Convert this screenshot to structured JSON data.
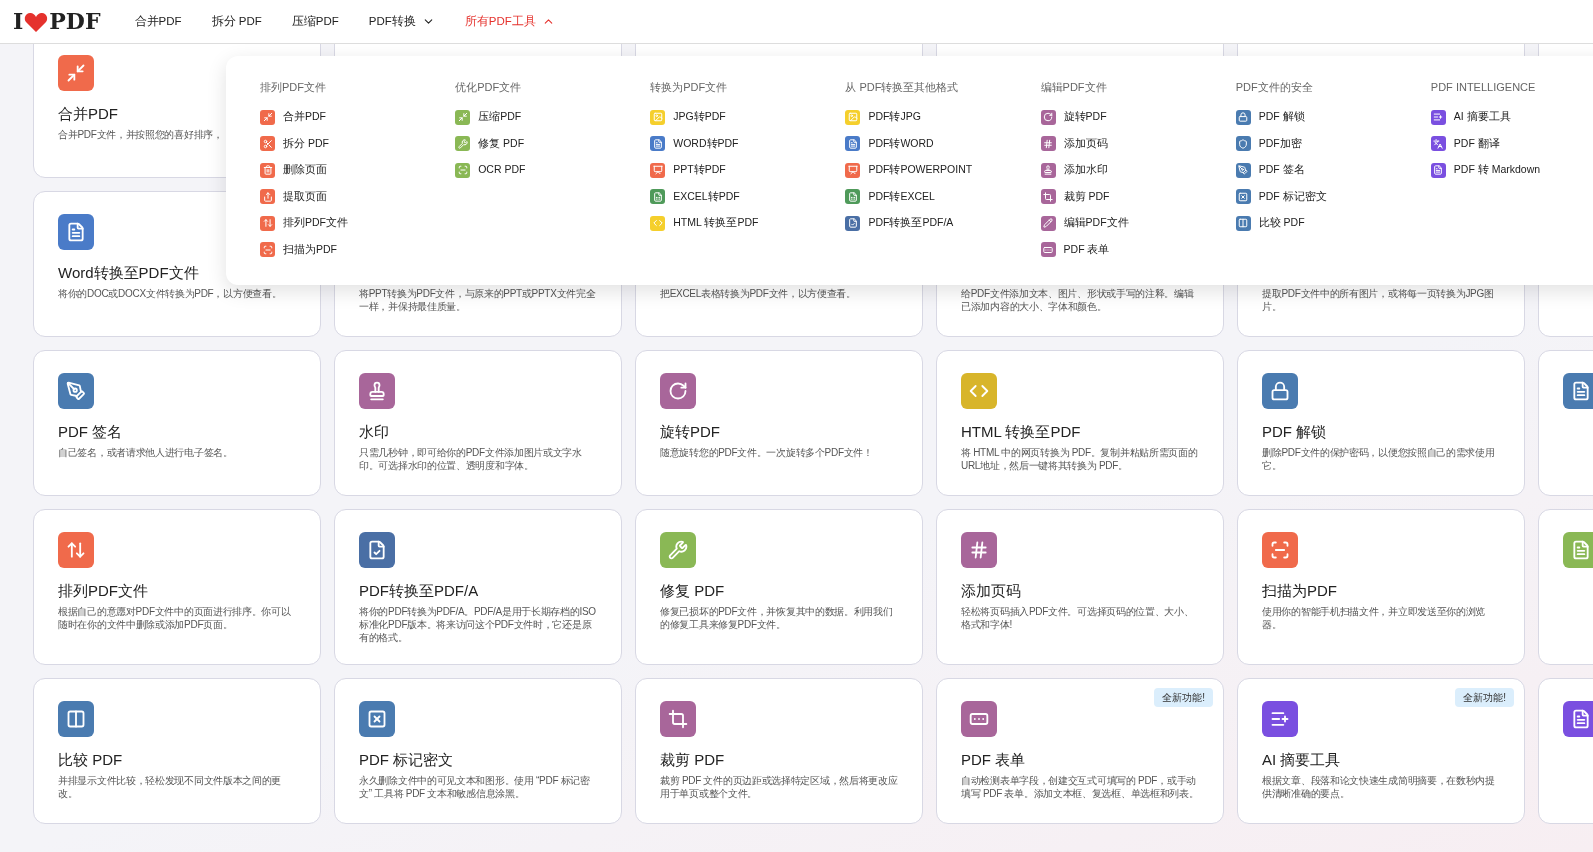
{
  "logo": {
    "left": "I",
    "right": "PDF"
  },
  "nav": [
    {
      "label": "合并PDF",
      "kind": "link",
      "selected": false
    },
    {
      "label": "拆分 PDF",
      "kind": "link",
      "selected": false
    },
    {
      "label": "压缩PDF",
      "kind": "link",
      "selected": false
    },
    {
      "label": "PDF转换",
      "kind": "menu",
      "selected": false,
      "expanded": false
    },
    {
      "label": "所有PDF工具",
      "kind": "menu",
      "selected": true,
      "expanded": true
    }
  ],
  "menu": [
    {
      "heading": "排列PDF文件",
      "items": [
        {
          "label": "合并PDF",
          "color": "#f06a4b"
        },
        {
          "label": "拆分 PDF",
          "color": "#f06a4b"
        },
        {
          "label": "删除页面",
          "color": "#f06a4b"
        },
        {
          "label": "提取页面",
          "color": "#f06a4b"
        },
        {
          "label": "排列PDF文件",
          "color": "#f06a4b"
        },
        {
          "label": "扫描为PDF",
          "color": "#f06a4b"
        }
      ]
    },
    {
      "heading": "优化PDF文件",
      "items": [
        {
          "label": "压缩PDF",
          "color": "#8ab855"
        },
        {
          "label": "修复 PDF",
          "color": "#8ab855"
        },
        {
          "label": "OCR PDF",
          "color": "#8ab855"
        }
      ]
    },
    {
      "heading": "转换为PDF文件",
      "items": [
        {
          "label": "JPG转PDF",
          "color": "#f5cf2c"
        },
        {
          "label": "WORD转PDF",
          "color": "#4a7bc8"
        },
        {
          "label": "PPT转PDF",
          "color": "#f06a4b"
        },
        {
          "label": "EXCEL转PDF",
          "color": "#4f9a5a"
        },
        {
          "label": "HTML 转换至PDF",
          "color": "#f5cf2c"
        }
      ]
    },
    {
      "heading": "从 PDF转换至其他格式",
      "items": [
        {
          "label": "PDF转JPG",
          "color": "#f5cf2c"
        },
        {
          "label": "PDF转WORD",
          "color": "#4a7bc8"
        },
        {
          "label": "PDF转POWERPOINT",
          "color": "#f06a4b"
        },
        {
          "label": "PDF转EXCEL",
          "color": "#4f9a5a"
        },
        {
          "label": "PDF转换至PDF/A",
          "color": "#4a6fa5"
        }
      ]
    },
    {
      "heading": "编辑PDF文件",
      "items": [
        {
          "label": "旋转PDF",
          "color": "#a8669a"
        },
        {
          "label": "添加页码",
          "color": "#a8669a"
        },
        {
          "label": "添加水印",
          "color": "#a8669a"
        },
        {
          "label": "裁剪 PDF",
          "color": "#a8669a"
        },
        {
          "label": "编辑PDF文件",
          "color": "#a8669a"
        },
        {
          "label": "PDF 表单",
          "color": "#a8669a"
        }
      ]
    },
    {
      "heading": "PDF文件的安全",
      "items": [
        {
          "label": "PDF 解锁",
          "color": "#4a7bb0"
        },
        {
          "label": "PDF加密",
          "color": "#4a7bb0"
        },
        {
          "label": "PDF 签名",
          "color": "#4a7bb0"
        },
        {
          "label": "PDF 标记密文",
          "color": "#4a7bb0"
        },
        {
          "label": "比较 PDF",
          "color": "#4a7bb0"
        }
      ]
    },
    {
      "heading": "PDF INTELLIGENCE",
      "items": [
        {
          "label": "AI 摘要工具",
          "color": "#7a4fe0"
        },
        {
          "label": "PDF 翻译",
          "color": "#7a4fe0"
        },
        {
          "label": "PDF 转 Markdown",
          "color": "#7a4fe0"
        }
      ]
    }
  ],
  "rows": [
    [
      {
        "color": "#f06a4b",
        "title": "合并PDF",
        "description": "合并PDF文件，并按照您的喜好排序，"
      },
      {},
      {},
      {},
      {},
      {}
    ],
    [
      {
        "color": "#4a7bc8",
        "title": "Word转换至PDF文件",
        "description": "将你的DOC或DOCX文件转换为PDF，以方便查看。"
      },
      {
        "description": "将PPT转换为PDF文件，与原来的PPT或PPTX文件完全一样，并保持最佳质量。"
      },
      {
        "description": "把EXCEL表格转换为PDF文件，以方便查看。"
      },
      {
        "description": "给PDF文件添加文本、图片、形状或手写的注释。编辑已添加内容的大小、字体和颜色。"
      },
      {
        "description": "提取PDF文件中的所有图片，或将每一页转换为JPG图片。"
      },
      {}
    ],
    [
      {
        "color": "#4a7bb0",
        "title": "PDF 签名",
        "description": "自己签名，或者请求他人进行电子签名。"
      },
      {
        "color": "#a8669a",
        "title": "水印",
        "description": "只需几秒钟，即可给你的PDF文件添加图片或文字水印。可选择水印的位置、透明度和字体。"
      },
      {
        "color": "#a8669a",
        "title": "旋转PDF",
        "description": "随意旋转您的PDF文件。一次旋转多个PDF文件！"
      },
      {
        "color": "#d8b52a",
        "title": "HTML 转换至PDF",
        "description": "将 HTML 中的网页转换为 PDF。复制并粘贴所需页面的URL地址，然后一键将其转换为 PDF。"
      },
      {
        "color": "#4a7bb0",
        "title": "PDF 解锁",
        "description": "删除PDF文件的保护密码，以便您按照自己的需求使用它。"
      },
      {
        "color": "#4a7bb0"
      }
    ],
    [
      {
        "color": "#f06a4b",
        "title": "排列PDF文件",
        "description": "根据自己的意愿对PDF文件中的页面进行排序。你可以随时在你的文件中删除或添加PDF页面。"
      },
      {
        "color": "#4a6fa5",
        "title": "PDF转换至PDF/A",
        "description": "将你的PDF转换为PDF/A。PDF/A是用于长期存档的ISO标准化PDF版本。将来访问这个PDF文件时，它还是原有的格式。"
      },
      {
        "color": "#8ab855",
        "title": "修复 PDF",
        "description": "修复已损坏的PDF文件，并恢复其中的数据。利用我们的修复工具来修复PDF文件。"
      },
      {
        "color": "#a8669a",
        "title": "添加页码",
        "description": "轻松将页码插入PDF文件。可选择页码的位置、大小、格式和字体!"
      },
      {
        "color": "#f06a4b",
        "title": "扫描为PDF",
        "description": "使用你的智能手机扫描文件，并立即发送至你的浏览器。"
      },
      {
        "color": "#8ab855"
      }
    ],
    [
      {
        "color": "#4a7bb0",
        "title": "比较 PDF",
        "description": "并排显示文件比较，轻松发现不同文件版本之间的更改。"
      },
      {
        "color": "#4a7bb0",
        "title": "PDF 标记密文",
        "description": "永久删除文件中的可见文本和图形。使用 “PDF 标记密文” 工具将 PDF 文本和敏感信息涂黑。"
      },
      {
        "color": "#a8669a",
        "title": "裁剪 PDF",
        "description": "裁剪 PDF 文件的页边距或选择特定区域，然后将更改应用于单页或整个文件。"
      },
      {
        "color": "#a8669a",
        "title": "PDF 表单",
        "badge": "全新功能!",
        "description": "自动检测表单字段，创建交互式可填写的 PDF，或手动填写 PDF 表单。添加文本框、复选框、单选框和列表。"
      },
      {
        "color": "#7a4fe0",
        "title": "AI 摘要工具",
        "badge": "全新功能!",
        "description": "根据文章、段落和论文快速生成简明摘要，在数秒内提供清晰准确的要点。"
      },
      {
        "color": "#7a4fe0"
      }
    ]
  ]
}
